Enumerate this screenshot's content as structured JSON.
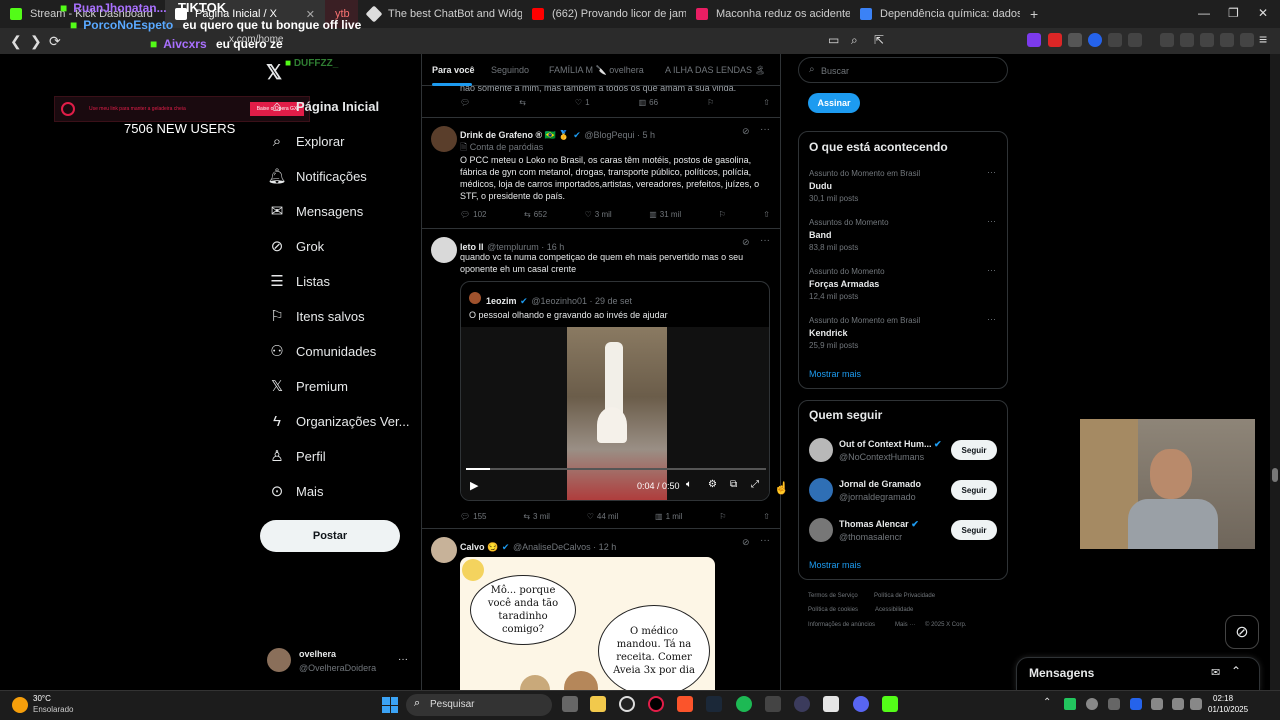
{
  "browser": {
    "tabs": [
      {
        "label": "Stream - Kick Dashboard",
        "color": "#53fc18"
      },
      {
        "label": "Página Inicial / X",
        "color": "#ffffff",
        "active": true
      },
      {
        "label": "ytb",
        "color": "#e11d48"
      },
      {
        "label": "The best ChatBot and Widgets for Ki",
        "color": "#dddddd"
      },
      {
        "label": "(662) Provando licor de jambu #corte",
        "color": "#ff0000"
      },
      {
        "label": "Maconha reduz os acidentes de trân",
        "color": "#e91e63"
      },
      {
        "label": "Dependência química: dados aponta",
        "color": "#3b82f6"
      }
    ],
    "new_tab": "+",
    "url": "x.com/home"
  },
  "stream_overlay": {
    "chat": [
      {
        "user": "RuanJhonatan...",
        "text": "TIKTOK",
        "color": "#a970ff"
      },
      {
        "user": "PorcoNoEspeto",
        "text": "eu quero que tu bongue off live",
        "color": "#5aa9ff"
      },
      {
        "user": "Aivcxrs",
        "text": "eu quero ze",
        "color": "#a970ff"
      }
    ],
    "user_fragment": "DUFFZZ_",
    "banner_text": "Use meu link para manter a geladeira cheia",
    "banner_button": "Baixe o Opera GX",
    "new_users": "7506 NEW USERS"
  },
  "sidebar": {
    "items": [
      {
        "label": "Página Inicial",
        "icon": "home-icon"
      },
      {
        "label": "Explorar",
        "icon": "search-icon"
      },
      {
        "label": "Notificações",
        "icon": "bell-icon"
      },
      {
        "label": "Mensagens",
        "icon": "mail-icon"
      },
      {
        "label": "Grok",
        "icon": "grok-icon"
      },
      {
        "label": "Listas",
        "icon": "list-icon"
      },
      {
        "label": "Itens salvos",
        "icon": "bookmark-icon"
      },
      {
        "label": "Comunidades",
        "icon": "people-icon"
      },
      {
        "label": "Premium",
        "icon": "x-logo-icon"
      },
      {
        "label": "Organizações Ver...",
        "icon": "lightning-icon"
      },
      {
        "label": "Perfil",
        "icon": "person-icon"
      },
      {
        "label": "Mais",
        "icon": "more-circle-icon"
      }
    ],
    "post_button": "Postar",
    "account": {
      "name": "ovelhera",
      "handle": "@OvelheraDoidera",
      "more": "···"
    }
  },
  "feed": {
    "tabs": [
      "Para você",
      "Seguindo",
      "FAMÍLIA M 🔪 ovelhera",
      "A ILHA DAS LENDAS 🏝"
    ],
    "top_fragment": "não somente a mim, mas também a todos os que amam a sua vinda.",
    "top_actions": {
      "replies": "",
      "reposts": "",
      "likes": "1",
      "views": "66"
    },
    "tweets": [
      {
        "name": "Drink de Grafeno ® 🇧🇷 🥇",
        "handle": "@BlogPequi · 5 h",
        "label": "Conta de paródias",
        "text": "O PCC meteu o Loko no Brasil, os caras têm motéis, postos de gasolina, fábrica de gyn com metanol, drogas, transporte público, políticos, polícia, médicos, loja de carros importados,artistas, vereadores, prefeitos, juízes, o STF, o presidente do país.",
        "replies": "102",
        "reposts": "652",
        "likes": "3 mil",
        "views": "31 mil"
      },
      {
        "name": "leto II",
        "handle": "@templurum · 16 h",
        "text": "quando vc ta numa competiçao de quem eh mais pervertido mas o seu oponente eh um casal crente",
        "quote": {
          "name": "1eozim",
          "handle": "@1eozinho01 · 29 de set",
          "text": "O pessoal olhando e gravando ao invés de ajudar"
        },
        "video_time": "0:04 / 0:50",
        "video_progress": 0.08,
        "replies": "155",
        "reposts": "3 mil",
        "likes": "44 mil",
        "views": "1 mil"
      },
      {
        "name": "Calvo 😏",
        "handle": "@AnaliseDeCalvos · 12 h",
        "comic_left": "Mô... porque você anda tão taradinho comigo?",
        "comic_right": "O médico mandou. Tá na receita. Comer Aveia 3x por dia"
      }
    ]
  },
  "right": {
    "search_placeholder": "Buscar",
    "subscribe": "Assinar",
    "trending_title": "O que está acontecendo",
    "trends": [
      {
        "meta": "Assunto do Momento em Brasil",
        "name": "Dudu",
        "posts": "30,1 mil posts"
      },
      {
        "meta": "Assuntos do Momento",
        "name": "Band",
        "posts": "83,8 mil posts"
      },
      {
        "meta": "Assunto do Momento",
        "name": "Forças Armadas",
        "posts": "12,4 mil posts"
      },
      {
        "meta": "Assunto do Momento em Brasil",
        "name": "Kendrick",
        "posts": "25,9 mil posts"
      }
    ],
    "show_more": "Mostrar mais",
    "who_title": "Quem seguir",
    "who": [
      {
        "name": "Out of Context Hum...",
        "handle": "@NoContextHumans",
        "verified": true
      },
      {
        "name": "Jornal de Gramado",
        "handle": "@jornaldegramado",
        "verified": false
      },
      {
        "name": "Thomas Alencar",
        "handle": "@thomasalencr",
        "verified": true
      }
    ],
    "follow_label": "Seguir",
    "footer": [
      "Termos de Serviço",
      "Política de Privacidade",
      "Política de cookies",
      "Acessibilidade",
      "Informações de anúncios",
      "Mais ···",
      "© 2025 X Corp."
    ],
    "messages": "Mensagens"
  },
  "taskbar": {
    "weather_temp": "30°C",
    "weather_desc": "Ensolarado",
    "search": "Pesquisar",
    "time": "02:18",
    "date": "01/10/2025"
  },
  "colors": {
    "accent": "#1d9bf0",
    "bg": "#000000",
    "border": "#2f3336"
  }
}
